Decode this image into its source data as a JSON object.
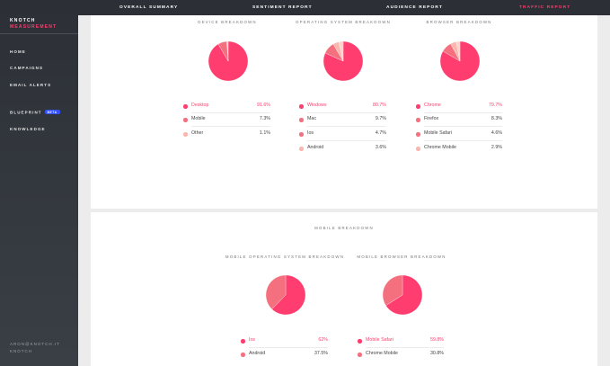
{
  "brand": {
    "line1": "KNOTCH",
    "line2": "MEASUREMENT"
  },
  "sidebar": {
    "items": [
      {
        "label": "HOME"
      },
      {
        "label": "CAMPAIGNS"
      },
      {
        "label": "EMAIL ALERTS"
      },
      {
        "label": "BLUEPRINT",
        "badge": "BETA"
      },
      {
        "label": "KNOWLEDGE"
      }
    ],
    "footer": {
      "email": "ARON@KNOTCH.IT",
      "org": "KNOTCH"
    }
  },
  "topnav": {
    "tabs": [
      {
        "label": "OVERALL SUMMARY"
      },
      {
        "label": "SENTIMENT REPORT"
      },
      {
        "label": "AUDIENCE REPORT"
      },
      {
        "label": "TRAFFIC REPORT",
        "active": true
      }
    ]
  },
  "colors": {
    "primary": "#ff3d6e",
    "secondary": "#f4707e",
    "light": "#fbb7ad",
    "lighter": "#fcd3c9"
  },
  "sections": {
    "device": {
      "title": "DEVICE BREAKDOWN",
      "rows": [
        {
          "label": "Desktop",
          "value": "91.6%"
        },
        {
          "label": "Mobile",
          "value": "7.3%"
        },
        {
          "label": "Other",
          "value": "1.1%"
        }
      ]
    },
    "os": {
      "title": "OPERATING SYSTEM BREAKDOWN",
      "rows": [
        {
          "label": "Windows",
          "value": "80.7%"
        },
        {
          "label": "Mac",
          "value": "9.7%"
        },
        {
          "label": "Ios",
          "value": "4.7%"
        },
        {
          "label": "Android",
          "value": "3.6%"
        }
      ]
    },
    "browser": {
      "title": "BROWSER BREAKDOWN",
      "rows": [
        {
          "label": "Chrome",
          "value": "79.7%"
        },
        {
          "label": "Firefox",
          "value": "8.3%"
        },
        {
          "label": "Mobile Safari",
          "value": "4.6%"
        },
        {
          "label": "Chrome Mobile",
          "value": "2.9%"
        }
      ]
    },
    "mobile_title": "MOBILE BREAKDOWN",
    "mobile_os": {
      "title": "MOBILE OPERATING SYSTEM BREAKDOWN",
      "rows": [
        {
          "label": "Ios",
          "value": "62%"
        },
        {
          "label": "Android",
          "value": "37.5%"
        }
      ]
    },
    "mobile_browser": {
      "title": "MOBILE BROWSER BREAKDOWN",
      "rows": [
        {
          "label": "Mobile Safari",
          "value": "59.8%"
        },
        {
          "label": "Chrome Mobile",
          "value": "30.8%"
        }
      ]
    }
  },
  "chart_data": [
    {
      "type": "pie",
      "title": "DEVICE BREAKDOWN",
      "categories": [
        "Desktop",
        "Mobile",
        "Other"
      ],
      "values": [
        91.6,
        7.3,
        1.1
      ]
    },
    {
      "type": "pie",
      "title": "OPERATING SYSTEM BREAKDOWN",
      "categories": [
        "Windows",
        "Mac",
        "Ios",
        "Android"
      ],
      "values": [
        80.7,
        9.7,
        4.7,
        3.6
      ]
    },
    {
      "type": "pie",
      "title": "BROWSER BREAKDOWN",
      "categories": [
        "Chrome",
        "Firefox",
        "Mobile Safari",
        "Chrome Mobile"
      ],
      "values": [
        79.7,
        8.3,
        4.6,
        2.9
      ]
    },
    {
      "type": "pie",
      "title": "MOBILE OPERATING SYSTEM BREAKDOWN",
      "categories": [
        "Ios",
        "Android"
      ],
      "values": [
        62,
        37.5
      ]
    },
    {
      "type": "pie",
      "title": "MOBILE BROWSER BREAKDOWN",
      "categories": [
        "Mobile Safari",
        "Chrome Mobile"
      ],
      "values": [
        59.8,
        30.8
      ]
    }
  ]
}
